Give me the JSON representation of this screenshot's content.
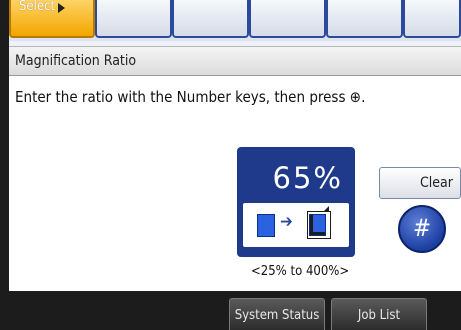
{
  "tabs": {
    "select_label": "Select"
  },
  "dialog": {
    "title": "Magnification Ratio",
    "instruction": "Enter the ratio with the Number keys, then press ⊕."
  },
  "ratio": {
    "value": "65%",
    "range": "<25% to 400%>"
  },
  "buttons": {
    "clear": "Clear",
    "hash": "#"
  },
  "bottom_bar": {
    "system_status": "System Status",
    "job_list": "Job List"
  },
  "colors": {
    "accent_blue": "#1f3a8a",
    "select_tab": "#f2a600"
  }
}
